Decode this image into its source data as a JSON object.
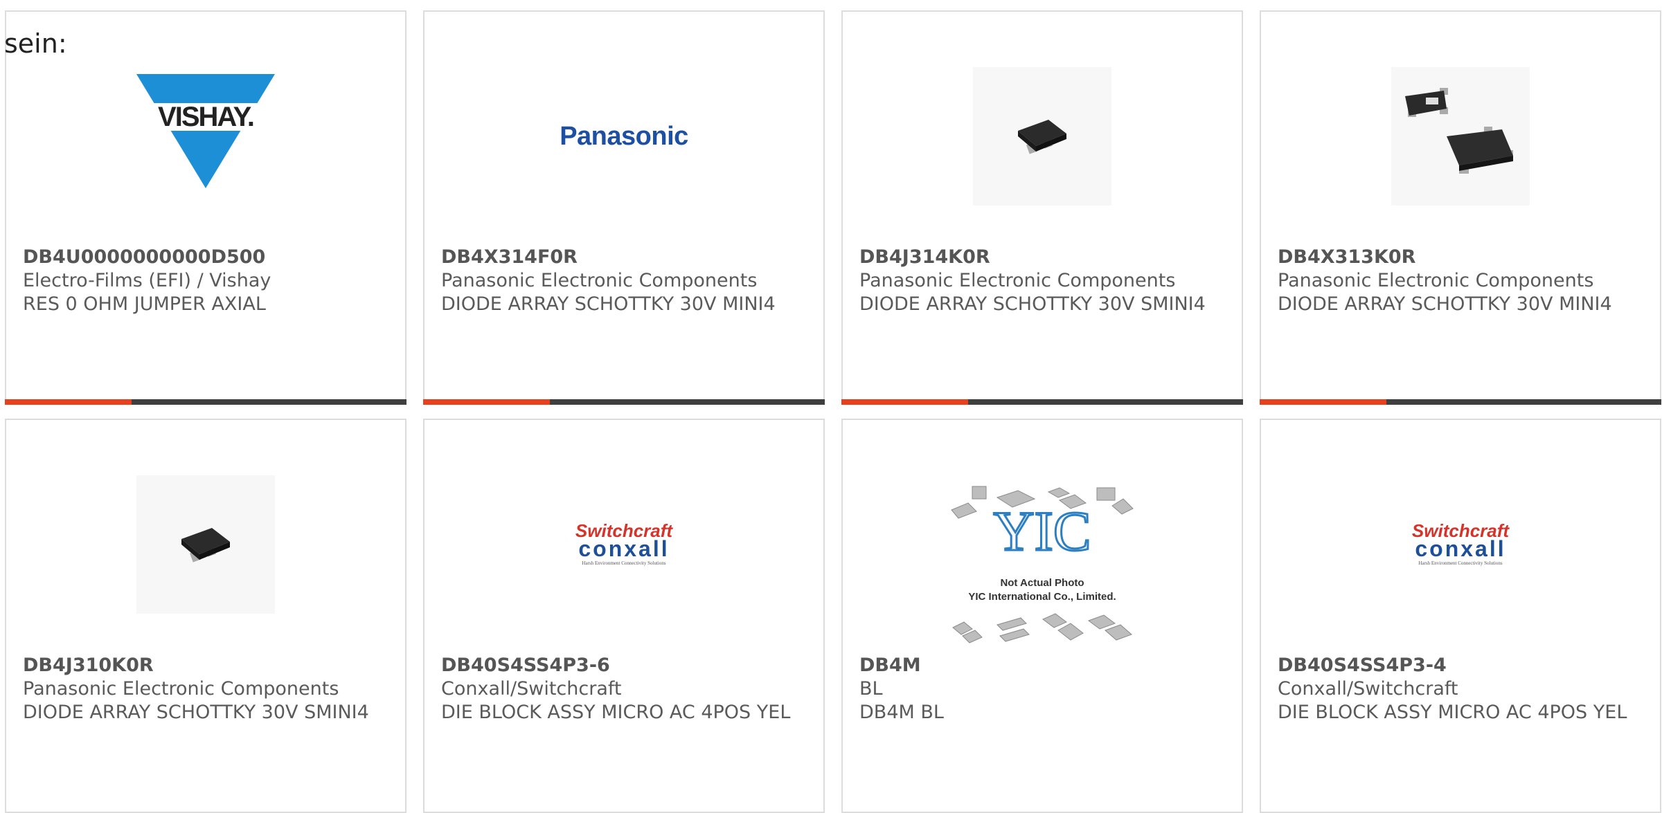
{
  "intro_text": "sein:",
  "colors": {
    "accent": "#e8401c",
    "bar": "#3f3f3f",
    "card_border": "#dcdcdc"
  },
  "products": [
    {
      "part_number": "DB4U0000000000D500",
      "manufacturer": "Electro-Films (EFI) / Vishay",
      "description": "RES 0 OHM JUMPER AXIAL",
      "image": "vishay-logo",
      "logo_text": "VISHAY."
    },
    {
      "part_number": "DB4X314F0R",
      "manufacturer": "Panasonic Electronic Components",
      "description": "DIODE ARRAY SCHOTTKY 30V MINI4",
      "image": "panasonic-logo",
      "logo_text": "Panasonic"
    },
    {
      "part_number": "DB4J314K0R",
      "manufacturer": "Panasonic Electronic Components",
      "description": "DIODE ARRAY SCHOTTKY 30V SMINI4",
      "image": "smd-package-photo"
    },
    {
      "part_number": "DB4X313K0R",
      "manufacturer": "Panasonic Electronic Components",
      "description": "DIODE ARRAY SCHOTTKY 30V MINI4",
      "image": "smd-package-photo"
    },
    {
      "part_number": "DB4J310K0R",
      "manufacturer": "Panasonic Electronic Components",
      "description": "DIODE ARRAY SCHOTTKY 30V SMINI4",
      "image": "smd-package-photo"
    },
    {
      "part_number": "DB40S4SS4P3-6",
      "manufacturer": "Conxall/Switchcraft",
      "description": "DIE BLOCK ASSY MICRO AC 4POS YEL",
      "image": "switchcraft-conxall-logo",
      "logo_line1": "Switchcraft",
      "logo_line2": "conxall",
      "logo_tagline": "Harsh Environment Connectivity Solutions"
    },
    {
      "part_number": "DB4M",
      "manufacturer": "BL",
      "description": "DB4M BL",
      "image": "yic-placeholder",
      "photo_note_1": "Not Actual Photo",
      "photo_note_2": "YIC International Co., Limited."
    },
    {
      "part_number": "DB40S4SS4P3-4",
      "manufacturer": "Conxall/Switchcraft",
      "description": "DIE BLOCK ASSY MICRO AC 4POS YEL",
      "image": "switchcraft-conxall-logo",
      "logo_line1": "Switchcraft",
      "logo_line2": "conxall",
      "logo_tagline": "Harsh Environment Connectivity Solutions"
    }
  ]
}
